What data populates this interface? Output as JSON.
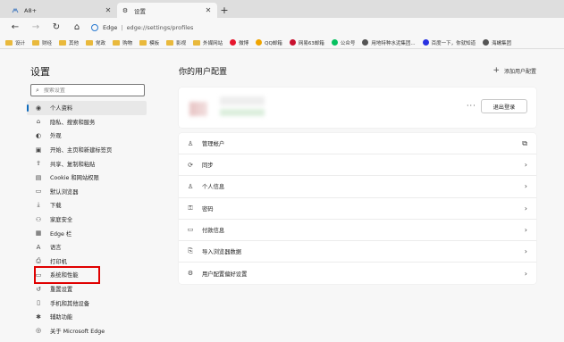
{
  "tabs": [
    {
      "title": "A8+",
      "icon": "app-favicon"
    },
    {
      "title": "设置",
      "icon": "gear-icon"
    }
  ],
  "address": {
    "label": "Edge",
    "url": "edge://settings/profiles"
  },
  "bookmarks": [
    {
      "label": "设计",
      "type": "folder"
    },
    {
      "label": "财经",
      "type": "folder"
    },
    {
      "label": "其他",
      "type": "folder"
    },
    {
      "label": "党政",
      "type": "folder"
    },
    {
      "label": "购物",
      "type": "folder"
    },
    {
      "label": "模板",
      "type": "folder"
    },
    {
      "label": "影视",
      "type": "folder"
    },
    {
      "label": "外媒网站",
      "type": "folder"
    },
    {
      "label": "微博",
      "type": "site",
      "color": "#e6162d"
    },
    {
      "label": "QQ邮箱",
      "type": "site",
      "color": "#f0a500"
    },
    {
      "label": "网易63邮箱",
      "type": "site",
      "color": "#c8102e"
    },
    {
      "label": "公众号",
      "type": "site",
      "color": "#07c160"
    },
    {
      "label": "用地特种水泥集团...",
      "type": "site",
      "color": "#555555"
    },
    {
      "label": "百度一下，你就知道",
      "type": "site",
      "color": "#2932e1"
    },
    {
      "label": "海螺集团",
      "type": "site",
      "color": "#555555"
    }
  ],
  "sidebar": {
    "title": "设置",
    "search_placeholder": "搜索设置",
    "items": [
      {
        "label": "个人资料",
        "icon": "profile-icon",
        "glyph": "◉",
        "active": true
      },
      {
        "label": "隐私、搜索和服务",
        "icon": "lock-icon",
        "glyph": "⌂"
      },
      {
        "label": "外观",
        "icon": "appearance-icon",
        "glyph": "◐"
      },
      {
        "label": "开始、主页和新建标签页",
        "icon": "home-icon",
        "glyph": "▣"
      },
      {
        "label": "共享、复制和粘贴",
        "icon": "share-icon",
        "glyph": "⇪"
      },
      {
        "label": "Cookie 和网站权限",
        "icon": "cookie-icon",
        "glyph": "▤"
      },
      {
        "label": "默认浏览器",
        "icon": "browser-icon",
        "glyph": "▭"
      },
      {
        "label": "下载",
        "icon": "download-icon",
        "glyph": "⤓"
      },
      {
        "label": "家庭安全",
        "icon": "family-icon",
        "glyph": "⚇"
      },
      {
        "label": "Edge 栏",
        "icon": "edge-bar-icon",
        "glyph": "▦"
      },
      {
        "label": "语言",
        "icon": "language-icon",
        "glyph": "A"
      },
      {
        "label": "打印机",
        "icon": "printer-icon",
        "glyph": "⎙"
      },
      {
        "label": "系统和性能",
        "icon": "system-icon",
        "glyph": "▭"
      },
      {
        "label": "重置设置",
        "icon": "reset-icon",
        "glyph": "↺"
      },
      {
        "label": "手机和其他设备",
        "icon": "phone-icon",
        "glyph": "▯"
      },
      {
        "label": "辅助功能",
        "icon": "accessibility-icon",
        "glyph": "✱"
      },
      {
        "label": "关于 Microsoft Edge",
        "icon": "edge-logo-icon",
        "glyph": "◎"
      }
    ]
  },
  "main": {
    "title": "你的用户配置",
    "add_profile": "添加用户配置",
    "logout": "退出登录",
    "options": [
      {
        "label": "管理帐户",
        "icon": "account-icon",
        "glyph": "♙",
        "action": "external-link-icon",
        "action_glyph": "⧉"
      },
      {
        "label": "同步",
        "icon": "sync-icon",
        "glyph": "⟳",
        "action": "chevron-right-icon",
        "action_glyph": "›"
      },
      {
        "label": "个人信息",
        "icon": "personal-info-icon",
        "glyph": "♙",
        "action": "chevron-right-icon",
        "action_glyph": "›"
      },
      {
        "label": "密码",
        "icon": "key-icon",
        "glyph": "⚿",
        "action": "chevron-right-icon",
        "action_glyph": "›"
      },
      {
        "label": "付款信息",
        "icon": "card-icon",
        "glyph": "▭",
        "action": "chevron-right-icon",
        "action_glyph": "›"
      },
      {
        "label": "导入浏览器数据",
        "icon": "import-icon",
        "glyph": "⎘",
        "action": "chevron-right-icon",
        "action_glyph": "›"
      },
      {
        "label": "用户配置偏好设置",
        "icon": "profile-prefs-icon",
        "glyph": "⚙",
        "action": "chevron-right-icon",
        "action_glyph": "›"
      }
    ]
  },
  "colors": {
    "accent": "#0f6cbd",
    "highlight": "#e00000"
  }
}
